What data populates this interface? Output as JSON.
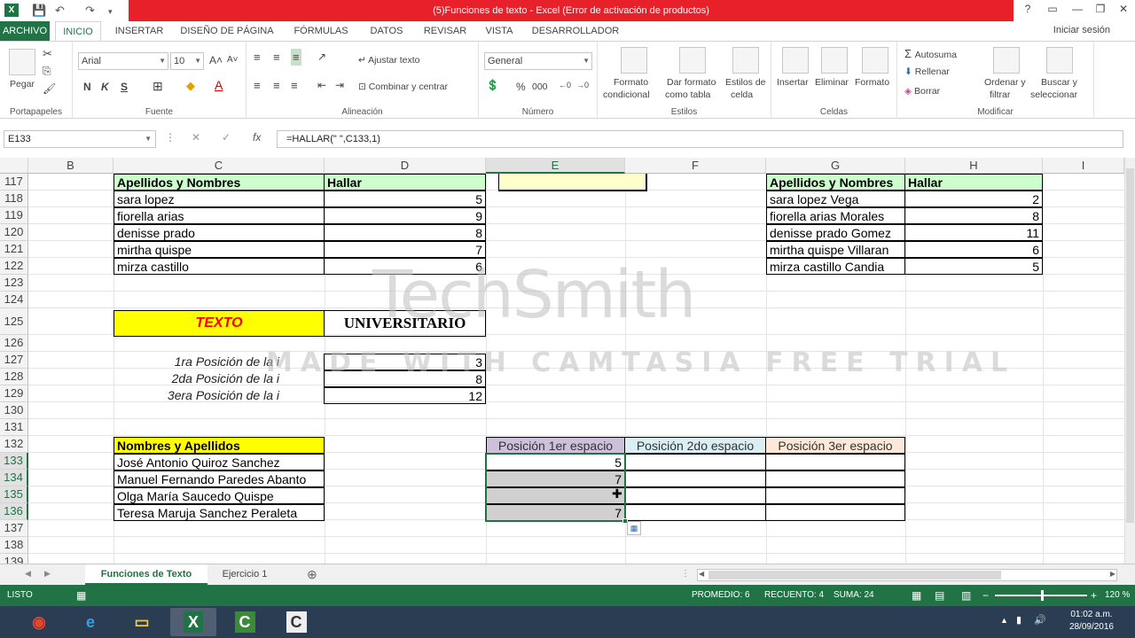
{
  "window": {
    "title": "(5)Funciones de texto -  Excel (Error de activación de productos)",
    "controls": [
      "?",
      "▭",
      "—",
      "❐",
      "✕"
    ]
  },
  "menu": {
    "tabs": [
      "ARCHIVO",
      "INICIO",
      "INSERTAR",
      "DISEÑO DE PÁGINA",
      "FÓRMULAS",
      "DATOS",
      "REVISAR",
      "VISTA",
      "DESARROLLADOR"
    ],
    "signin": "Iniciar sesión"
  },
  "ribbon": {
    "portapapeles": {
      "label": "Portapapeles",
      "paste": "Pegar"
    },
    "fuente": {
      "label": "Fuente",
      "font_name": "Arial",
      "font_size": "10",
      "bold": "N",
      "italic": "K",
      "underline": "S"
    },
    "alineacion": {
      "label": "Alineación",
      "wrap": "Ajustar texto",
      "merge": "Combinar y centrar"
    },
    "numero": {
      "label": "Número",
      "format": "General",
      "percent": "%",
      "thousands": "000"
    },
    "estilos": {
      "label": "Estilos",
      "cond1": "Formato",
      "cond2": "condicional",
      "table1": "Dar formato",
      "table2": "como tabla",
      "cell1": "Estilos de",
      "cell2": "celda"
    },
    "celdas": {
      "label": "Celdas",
      "insert": "Insertar",
      "delete": "Eliminar",
      "format": "Formato"
    },
    "modificar": {
      "label": "Modificar",
      "autosum": "Autosuma",
      "fill": "Rellenar",
      "clear": "Borrar",
      "sort1": "Ordenar y",
      "sort2": "filtrar",
      "find1": "Buscar y",
      "find2": "seleccionar"
    }
  },
  "formula_bar": {
    "name_box": "E133",
    "fx": "fx",
    "formula": "=HALLAR(\" \",C133,1)"
  },
  "columns": [
    "B",
    "C",
    "D",
    "E",
    "F",
    "G",
    "H",
    "I"
  ],
  "rows": [
    "117",
    "118",
    "119",
    "120",
    "121",
    "122",
    "123",
    "124",
    "125",
    "126",
    "127",
    "128",
    "129",
    "130",
    "131",
    "132",
    "133",
    "134",
    "135",
    "136",
    "137",
    "138",
    "139"
  ],
  "table1": {
    "header_name": "Apellidos y Nombres",
    "header_find": "Hallar",
    "rows": [
      {
        "name": "sara lopez",
        "val": "5"
      },
      {
        "name": "fiorella arias",
        "val": "9"
      },
      {
        "name": "denisse prado",
        "val": "8"
      },
      {
        "name": "mirtha quispe",
        "val": "7"
      },
      {
        "name": "mirza castillo",
        "val": "6"
      }
    ]
  },
  "table2": {
    "header_name": "Apellidos y Nombres",
    "header_find": "Hallar",
    "rows": [
      {
        "name": "sara lopez Vega",
        "val": "2"
      },
      {
        "name": "fiorella arias Morales",
        "val": "8"
      },
      {
        "name": "denisse prado Gomez",
        "val": "11"
      },
      {
        "name": "mirtha quispe Villaran",
        "val": "6"
      },
      {
        "name": "mirza castillo Candia",
        "val": "5"
      }
    ]
  },
  "texto_block": {
    "label": "TEXTO",
    "value": "UNIVERSITARIO",
    "positions": [
      {
        "label": "1ra Posición de la i",
        "val": "3"
      },
      {
        "label": "2da Posición de la i",
        "val": "8"
      },
      {
        "label": "3era Posición de la i",
        "val": "12"
      }
    ]
  },
  "table3": {
    "header_name": "Nombres y Apellidos",
    "header_pos1": "Posición 1er espacio",
    "header_pos2": "Posición 2do espacio",
    "header_pos3": "Posición 3er espacio",
    "rows": [
      {
        "name": "José Antonio Quiroz Sanchez",
        "pos1": "5"
      },
      {
        "name": "Manuel Fernando Paredes Abanto",
        "pos1": "7"
      },
      {
        "name": "Olga María Saucedo Quispe",
        "pos1": ""
      },
      {
        "name": "Teresa Maruja Sanchez Peraleta",
        "pos1": "7"
      }
    ]
  },
  "watermark": {
    "line1": "TechSmith",
    "line2": "MADE WITH CAMTASIA FREE TRIAL"
  },
  "sheets": {
    "tabs": [
      "Funciones de Texto",
      "Ejercicio 1"
    ],
    "add": "⊕"
  },
  "status": {
    "mode": "LISTO",
    "average": "PROMEDIO: 6",
    "count": "RECUENTO: 4",
    "sum": "SUMA: 24",
    "zoom": "120 %"
  },
  "taskbar": {
    "time": "01:02 a.m.",
    "date": "28/09/2016"
  },
  "colors": {
    "excel_green": "#217346",
    "title_red": "#e8202a",
    "header_green": "#ccffcc",
    "header_yellow": "#ffff00",
    "header_purple": "#ccc0da",
    "header_blue": "#daeef3",
    "header_peach": "#fde9d9",
    "texto_red": "#ff0000"
  }
}
